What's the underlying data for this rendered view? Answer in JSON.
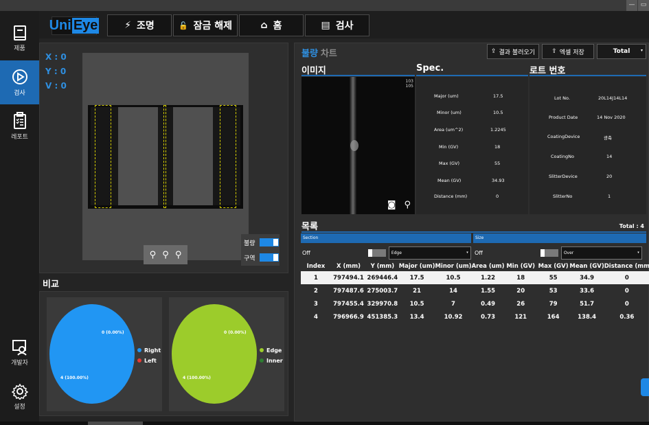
{
  "window": {
    "min": "—",
    "max": "▭"
  },
  "nav": {
    "items": [
      {
        "label": "제품"
      },
      {
        "label": "검사"
      },
      {
        "label": "레포트"
      },
      {
        "label": "개발자"
      },
      {
        "label": "설정"
      }
    ]
  },
  "toolbar": {
    "logo_uni": "Uni",
    "logo_eye": "Eye",
    "buttons": [
      {
        "label": "조명",
        "icon": "⚡"
      },
      {
        "label": "잠금 해제",
        "icon": "🔓"
      },
      {
        "label": "홈",
        "icon": "⌂"
      },
      {
        "label": "검사",
        "icon": "▤"
      }
    ]
  },
  "viewer": {
    "x": "X : 0",
    "y": "Y : 0",
    "v": "V : 0",
    "toggle_defect": "불량",
    "toggle_zone": "구역"
  },
  "compare": {
    "title": "비교",
    "pie1": {
      "label_top": "0 (0.00%)",
      "label_bottom": "4 (100.00%)",
      "legend": [
        "Right",
        "Left"
      ],
      "colors": [
        "#2196f3",
        "#e53935"
      ]
    },
    "pie2": {
      "label_top": "0 (0.00%)",
      "label_bottom": "4 (100.00%)",
      "legend": [
        "Edge",
        "Inner"
      ],
      "colors": [
        "#9ccc2b",
        "#2e7d32"
      ]
    }
  },
  "right": {
    "tab_active": "불량",
    "tab_inactive": "차트",
    "btn_load": "결과 불러오기",
    "btn_excel": "엑셀 저장",
    "select_total": "Total",
    "image_header": "이미지",
    "spec_header": "Spec.",
    "lot_header": "로트 번호",
    "scale_top": "103",
    "scale_bottom": "105",
    "spec": [
      {
        "k": "Major (um)",
        "v": "17.5"
      },
      {
        "k": "Minor (um)",
        "v": "10.5"
      },
      {
        "k": "Area (um^2)",
        "v": "1.2245"
      },
      {
        "k": "Min (GV)",
        "v": "18"
      },
      {
        "k": "Max (GV)",
        "v": "55"
      },
      {
        "k": "Mean (GV)",
        "v": "34.93"
      },
      {
        "k": "Distance (mm)",
        "v": "0"
      }
    ],
    "lot": [
      {
        "k": "Lot No.",
        "v": "20L14J14L14"
      },
      {
        "k": "Product Date",
        "v": "14 Nov 2020"
      },
      {
        "k": "CoatingDevice",
        "v": "광축"
      },
      {
        "k": "CoatingNo",
        "v": "14"
      },
      {
        "k": "SlitterDevice",
        "v": "20"
      },
      {
        "k": "SlitterNo",
        "v": "1"
      }
    ],
    "list_header": "목록",
    "total": "Total : 4",
    "filter_section": "Section",
    "filter_size": "Size",
    "filter_section_state": "Off",
    "filter_size_state": "Off",
    "filter_section_value": "Edge",
    "filter_size_value": "Over",
    "columns": [
      "Index",
      "X (mm)",
      "Y (mm)",
      "Major (um)",
      "Minor (um)",
      "Area (um)",
      "Min (GV)",
      "Max (GV)",
      "Mean (GV)",
      "Distance (mm"
    ],
    "rows": [
      [
        "1",
        "797494.1",
        "269446.4",
        "17.5",
        "10.5",
        "1.22",
        "18",
        "55",
        "34.9",
        "0"
      ],
      [
        "2",
        "797487.6",
        "275003.7",
        "21",
        "14",
        "1.55",
        "20",
        "53",
        "33.6",
        "0"
      ],
      [
        "3",
        "797455.4",
        "329970.8",
        "10.5",
        "7",
        "0.49",
        "26",
        "79",
        "51.7",
        "0"
      ],
      [
        "4",
        "796966.9",
        "451385.3",
        "13.4",
        "10.92",
        "0.73",
        "121",
        "164",
        "138.4",
        "0.36"
      ]
    ]
  }
}
